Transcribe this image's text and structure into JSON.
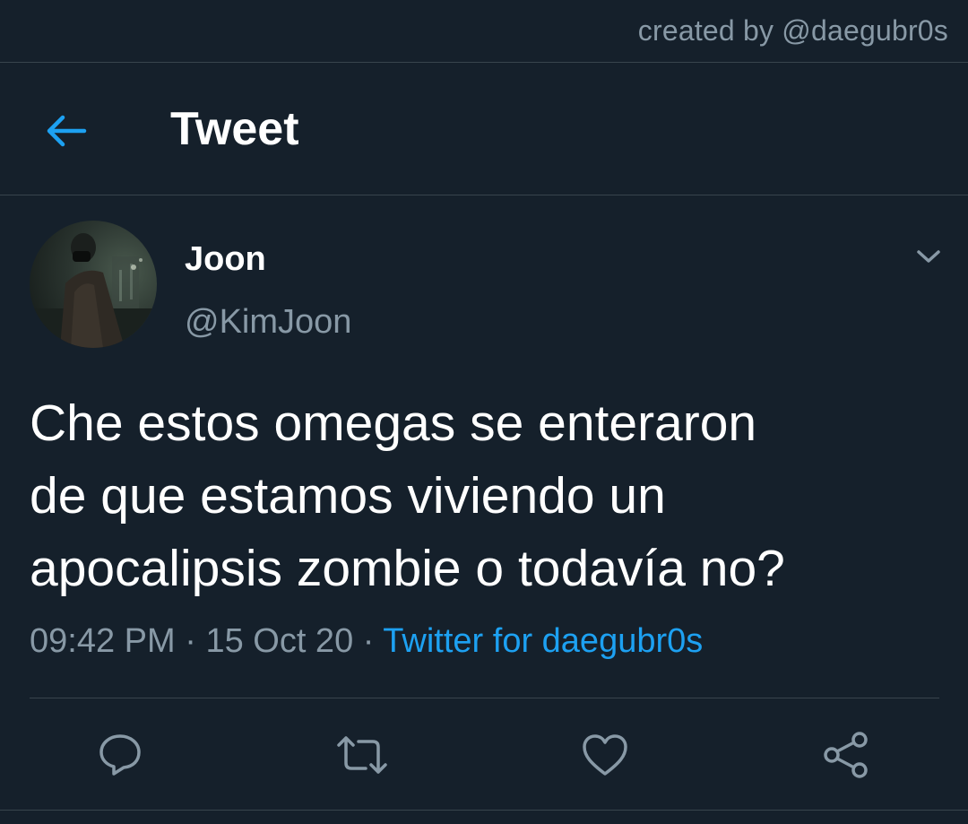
{
  "credit": {
    "text": "created by @daegubr0s"
  },
  "header": {
    "back_icon": "arrow-left-icon",
    "title": "Tweet"
  },
  "author": {
    "display_name": "Joon",
    "handle": "@KimJoon",
    "avatar_icon": "avatar-photo"
  },
  "tweet": {
    "text_lines": [
      "Che estos omegas se enteraron",
      "de que estamos viviendo un",
      "apocalipsis zombie o todavía no?"
    ],
    "time": "09:42 PM",
    "date": "15 Oct 20",
    "separator": " · ",
    "source": "Twitter for daegubr0s"
  },
  "actions": {
    "icons": [
      "reply-icon",
      "retweet-icon",
      "like-icon",
      "share-icon"
    ]
  },
  "colors": {
    "background": "#15202b",
    "accent": "#1da1f2",
    "muted": "#8899a6",
    "border": "#38444d"
  }
}
